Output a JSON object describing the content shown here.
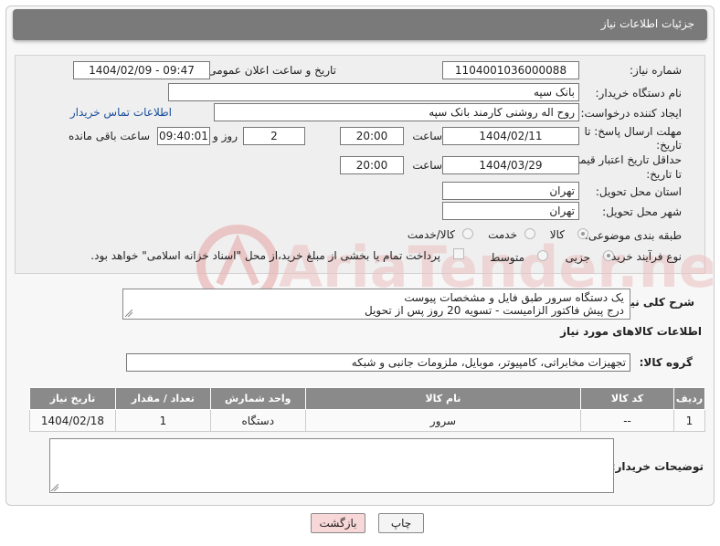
{
  "header": {
    "title": "جزئیات اطلاعات نیاز"
  },
  "need_number": {
    "label": "شماره نیاز:",
    "value": "1104001036000088"
  },
  "announce": {
    "label": "تاریخ و ساعت اعلان عمومی:",
    "value": "1404/02/09 - 09:47"
  },
  "buyer_org": {
    "label": "نام دستگاه خریدار:",
    "value": "بانک سپه"
  },
  "requester": {
    "label": "ایجاد کننده درخواست:",
    "value": "روح اله روشنی کارمند بانک سپه",
    "contact_link": "اطلاعات تماس خریدار"
  },
  "reply_deadline": {
    "label_line1": "مهلت ارسال پاسخ: تا",
    "label_line2": "تاریخ:",
    "date": "1404/02/11",
    "time_label": "ساعت",
    "time": "20:00",
    "days": "2",
    "days_label": "روز و",
    "remaining": "09:40:01",
    "remaining_label": "ساعت باقی مانده"
  },
  "price_validity": {
    "label_line1": "حداقل تاریخ اعتبار قیمت:",
    "label_line2": "تا تاریخ:",
    "date": "1404/03/29",
    "time_label": "ساعت",
    "time": "20:00"
  },
  "delivery_province": {
    "label": "استان محل تحویل:",
    "value": "تهران"
  },
  "delivery_city": {
    "label": "شهر محل تحویل:",
    "value": "تهران"
  },
  "category": {
    "label": "طبقه بندی موضوعی:",
    "options": [
      "کالا",
      "خدمت",
      "کالا/خدمت"
    ],
    "selected": "کالا"
  },
  "process": {
    "label": "نوع فرآیند خرید :",
    "options": [
      "جزیی",
      "متوسط"
    ],
    "payment_note": "پرداخت تمام یا بخشی از مبلغ خرید،از محل \"اسناد خزانه اسلامی\" خواهد بود."
  },
  "description": {
    "label": "شرح کلی نیاز:",
    "line1": "یک دستگاه سرور طبق فایل و مشخصات پیوست",
    "line2": "درج پیش فاکتور الزامیست - تسویه 20 روز پس از تحویل"
  },
  "goods_info_title": "اطلاعات کالاهای مورد نیاز",
  "goods_group": {
    "label": "گروه کالا:",
    "value": "تجهیزات مخابراتی، کامپیوتر، موبایل، ملزومات جانبی و شبکه"
  },
  "table": {
    "headers": [
      "ردیف",
      "کد کالا",
      "نام کالا",
      "واحد شمارش",
      "تعداد / مقدار",
      "تاریخ نیاز"
    ],
    "rows": [
      [
        "1",
        "--",
        "سرور",
        "دستگاه",
        "1",
        "1404/02/18"
      ]
    ]
  },
  "buyer_notes": {
    "label": "توضیحات خریدار:",
    "value": ""
  },
  "buttons": {
    "print": "چاپ",
    "back": "بازگشت"
  },
  "watermark": {
    "text": "AriaTender.neT"
  },
  "colors": {
    "header": "#7a7a7a",
    "link": "#1a4e9c",
    "back_button": "#f7d7d7",
    "watermark": "#e2a8a8"
  }
}
